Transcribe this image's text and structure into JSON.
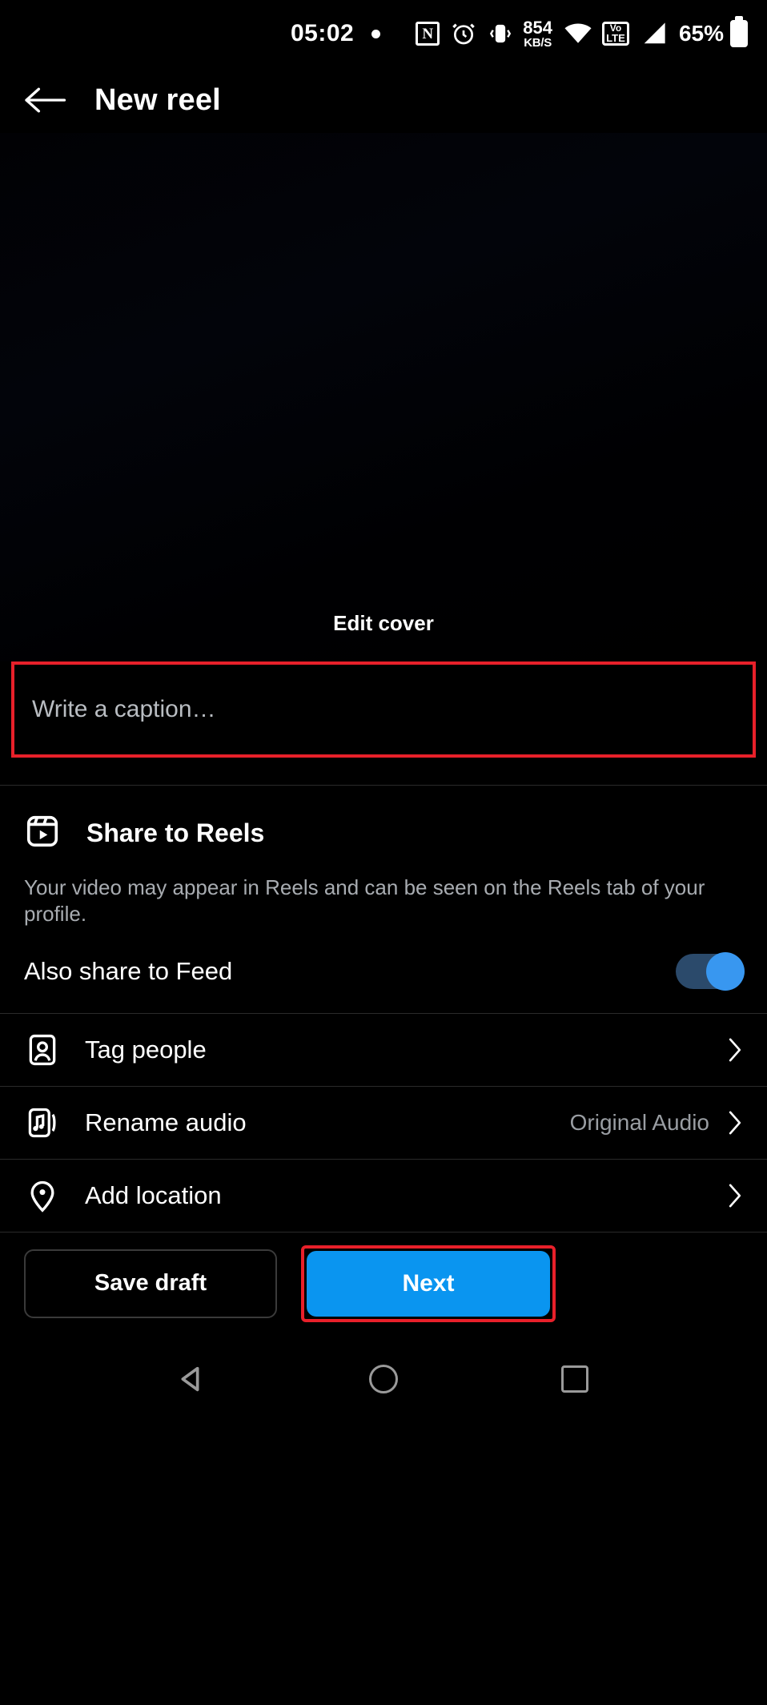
{
  "status_bar": {
    "time": "05:02",
    "dot_icon": "dot-indicator",
    "nfc_icon": "nfc-icon",
    "nfc_glyph": "N",
    "alarm_icon": "alarm-clock-icon",
    "vibrate_icon": "vibrate-icon",
    "network_speed_value": "854",
    "network_speed_unit": "KB/S",
    "wifi_icon": "wifi-icon",
    "volte_top": "Vo",
    "volte_bottom": "LTE",
    "signal_icon": "cellular-signal-icon",
    "battery_percent": "65%",
    "battery_icon": "battery-icon"
  },
  "header": {
    "back_icon": "back-arrow-icon",
    "title": "New reel"
  },
  "preview": {
    "edit_cover_label": "Edit cover"
  },
  "caption": {
    "placeholder": "Write a caption…",
    "highlight_color": "#e8202a"
  },
  "share_section": {
    "icon": "reels-icon",
    "title": "Share to Reels",
    "description": "Your video may appear in Reels and can be seen on the Reels tab of your profile.",
    "feed_toggle_label": "Also share to Feed",
    "feed_toggle_state": "on",
    "toggle_color": "#3897f0"
  },
  "options": [
    {
      "icon": "tag-people-icon",
      "label": "Tag people",
      "value": "",
      "chevron": "chevron-right-icon"
    },
    {
      "icon": "audio-note-icon",
      "label": "Rename audio",
      "value": "Original Audio",
      "chevron": "chevron-right-icon"
    },
    {
      "icon": "location-pin-icon",
      "label": "Add location",
      "value": "",
      "chevron": "chevron-right-icon"
    }
  ],
  "actions": {
    "save_draft_label": "Save draft",
    "next_label": "Next",
    "next_color": "#0a95f0",
    "next_highlight_color": "#e8202a"
  },
  "nav_bar": {
    "back_icon": "nav-back-triangle-icon",
    "home_icon": "nav-home-circle-icon",
    "recents_icon": "nav-recents-square-icon"
  }
}
